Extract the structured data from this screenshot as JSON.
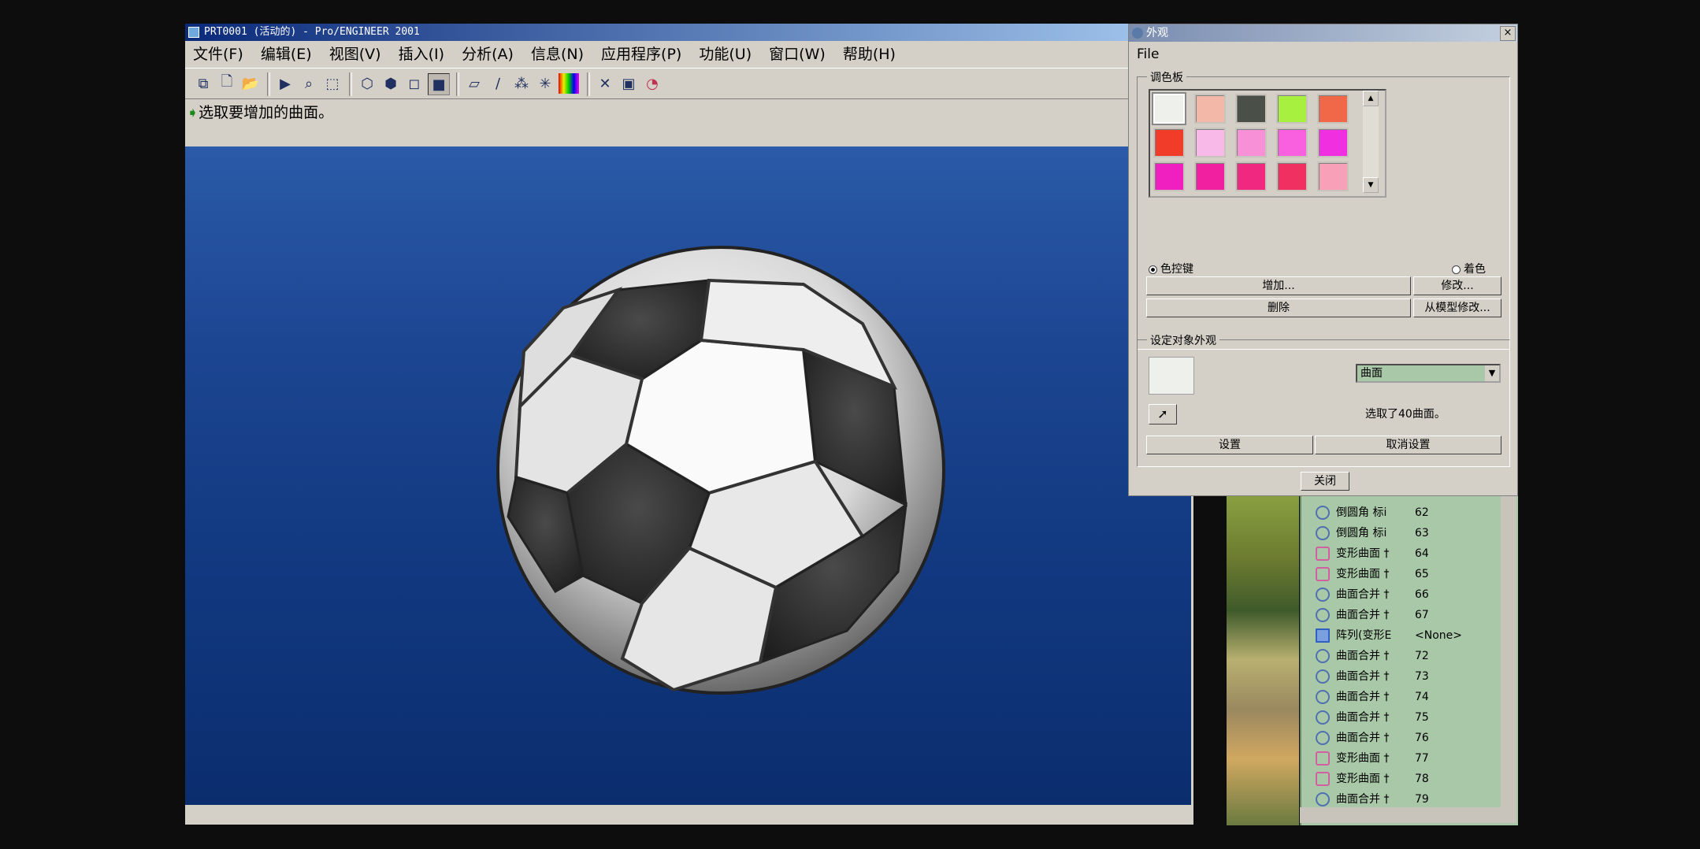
{
  "main_window": {
    "title": "PRT0001 (活动的) - Pro/ENGINEER 2001",
    "menu": [
      "文件(F)",
      "编辑(E)",
      "视图(V)",
      "插入(I)",
      "分析(A)",
      "信息(N)",
      "应用程序(P)",
      "功能(U)",
      "窗口(W)",
      "帮助(H)"
    ],
    "message": "选取要增加的曲面。"
  },
  "dialog": {
    "title": "外观",
    "close_glyph": "×",
    "menu_file": "File",
    "palette_label": "调色板",
    "palette_colors": [
      "#eef0ec",
      "#f4b8a8",
      "#4a5048",
      "#a8f040",
      "#f06848",
      "#f03c28",
      "#f8b8e8",
      "#f890d8",
      "#f860e0",
      "#f030e0",
      "#f020c0",
      "#f020a0",
      "#f02880",
      "#f03060",
      "#f8a0b8"
    ],
    "radio_color_key": "色控键",
    "radio_tint": "着色",
    "btn_add": "增加...",
    "btn_modify": "修改...",
    "btn_delete": "删除",
    "btn_modify_from_model": "从模型修改...",
    "set_appearance_label": "设定对象外观",
    "object_type": "曲面",
    "selected_text": "选取了40曲面。",
    "btn_set": "设置",
    "btn_unset": "取消设置",
    "btn_close": "关闭"
  },
  "tree": {
    "rows": [
      {
        "name": "倒圆角 标i",
        "id": "62",
        "icon": "round"
      },
      {
        "name": "倒圆角 标i",
        "id": "63",
        "icon": "round"
      },
      {
        "name": "变形曲面 †",
        "id": "64",
        "icon": "warp"
      },
      {
        "name": "变形曲面 †",
        "id": "65",
        "icon": "warp"
      },
      {
        "name": "曲面合并 †",
        "id": "66",
        "icon": "merge"
      },
      {
        "name": "曲面合并 †",
        "id": "67",
        "icon": "merge"
      },
      {
        "name": "阵列(变形E",
        "id": "<None>",
        "icon": "pattern"
      },
      {
        "name": "曲面合并 †",
        "id": "72",
        "icon": "merge"
      },
      {
        "name": "曲面合并 †",
        "id": "73",
        "icon": "merge"
      },
      {
        "name": "曲面合并 †",
        "id": "74",
        "icon": "merge"
      },
      {
        "name": "曲面合并 †",
        "id": "75",
        "icon": "merge"
      },
      {
        "name": "曲面合并 †",
        "id": "76",
        "icon": "merge"
      },
      {
        "name": "变形曲面 †",
        "id": "77",
        "icon": "warp"
      },
      {
        "name": "变形曲面 †",
        "id": "78",
        "icon": "warp"
      },
      {
        "name": "曲面合并 †",
        "id": "79",
        "icon": "merge"
      }
    ]
  }
}
